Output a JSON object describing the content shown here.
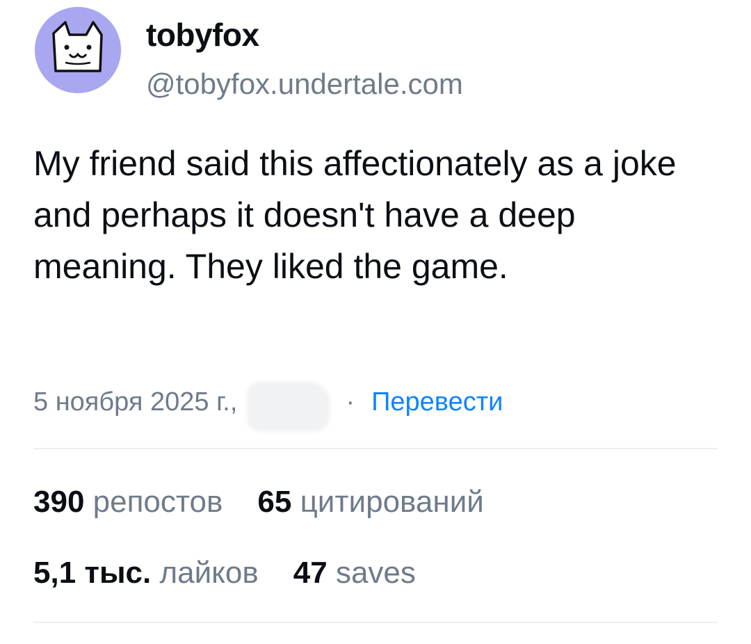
{
  "author": {
    "display_name": "tobyfox",
    "handle": "@tobyfox.undertale.com",
    "avatar_icon": "cat-face-icon",
    "avatar_bg": "#a9a7f0"
  },
  "post": {
    "text": "My friend said this affectionately as a joke and perhaps it doesn't have a deep meaning. They liked the game.",
    "date": "5 ноября 2025 г.,",
    "separator": "·",
    "translate_label": "Перевести"
  },
  "stats": {
    "reposts": {
      "count": "390",
      "label": "репостов"
    },
    "quotes": {
      "count": "65",
      "label": "цитирований"
    },
    "likes": {
      "count": "5,1 тыс.",
      "label": "лайков"
    },
    "saves": {
      "count": "47",
      "label": "saves"
    }
  },
  "colors": {
    "text": "#0b0f14",
    "secondary": "#6f7b8a",
    "link": "#1083fe",
    "divider": "#eceff2"
  }
}
